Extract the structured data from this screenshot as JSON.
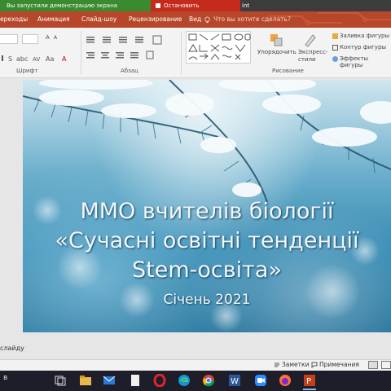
{
  "share": {
    "info_text": "Вы запустили демонстрацию экрана",
    "stop_label": "Остановить демонстрацию",
    "title_fragment": "int"
  },
  "tabs": [
    "ереходы",
    "Анимация",
    "Слайд-шоу",
    "Рецензирование",
    "Вид"
  ],
  "tell_me": "Что вы хотите сделать?",
  "ribbon": {
    "font_group": "Шрифт",
    "paragraph_group": "Абзац",
    "drawing_group": "Рисование",
    "arrange_label": "Упорядочить",
    "styles_label": "Экспресс-стили",
    "shape_fill": "Заливка фигуры",
    "shape_outline": "Контур фигуры",
    "shape_effects": "Эффекты фигуры",
    "font_size_value": "A"
  },
  "slide": {
    "line1": "ММО вчителів біології",
    "line2": "«Сучасні освітні тенденції",
    "line3": "Stem-освіта»",
    "date": "Січень 2021"
  },
  "notes_hint": "слайду",
  "status": {
    "notes": "Заметки",
    "comments": "Примечания"
  },
  "taskbar": {
    "search_fragment": "в"
  },
  "colors": {
    "accent": "#b7472a",
    "share_green": "#3a8a2f",
    "stop_red": "#c42b1c"
  }
}
